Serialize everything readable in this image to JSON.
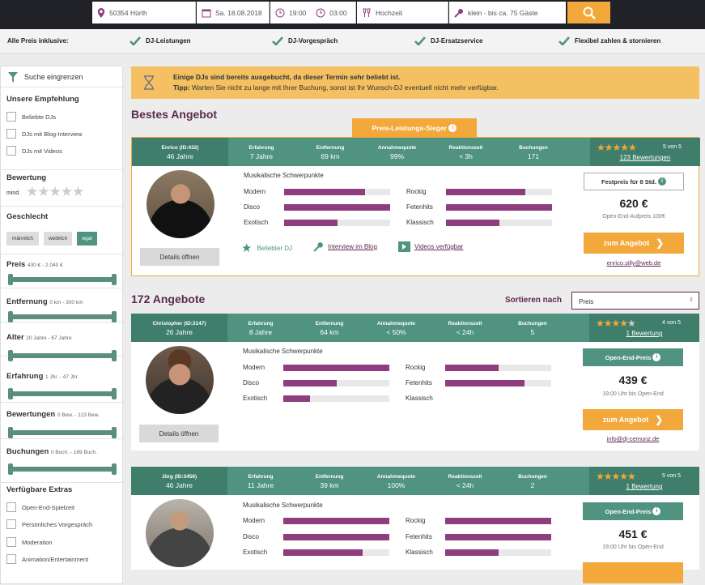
{
  "search": {
    "location": "50354 Hürth",
    "date": "Sa. 18.08.2018",
    "time_from": "19:00",
    "time_to": "03:00",
    "event": "Hochzeit",
    "size": "klein - bis ca. 75 Gäste"
  },
  "inclusive": {
    "label": "Alle Preis inklusive:",
    "items": [
      "DJ-Leistungen",
      "DJ-Vorgespräch",
      "DJ-Ersatzservice",
      "Flexibel zahlen & stornieren"
    ]
  },
  "sidebar": {
    "filter": "Suche eingrenzen",
    "recommend": "Unsere Empfehlung",
    "recommend_items": [
      "Beliebte DJs",
      "DJs mit Blog-Interview",
      "DJs mit Videos"
    ],
    "rating": "Bewertung",
    "rating_min": "mind.",
    "gender": "Geschlecht",
    "gender_opts": [
      "männlich",
      "weiblich",
      "egal"
    ],
    "price": "Preis",
    "price_range": "430 € - 2.040 €",
    "distance": "Entfernung",
    "distance_range": "0 km - 300 km",
    "age": "Alter",
    "age_range": "20 Jahre - 67 Jahre",
    "exp": "Erfahrung",
    "exp_range": "1 Jhr. - 47 Jhr.",
    "reviews": "Bewertungen",
    "reviews_range": "0 Bew. - 123 Bew.",
    "bookings": "Buchungen",
    "bookings_range": "0 Buch. - 189 Buch.",
    "extras": "Verfügbare Extras",
    "extras_items": [
      "Open-End-Spielzeit",
      "Persönliches Vorgespräch",
      "Moderation",
      "Animation/Entertainment"
    ]
  },
  "banner": {
    "line1": "Einige DJs sind bereits ausgebucht, da dieser Termin sehr beliebt ist.",
    "tip_label": "Tipp:",
    "tip": "Warten Sie nicht zu lange mit Ihrer Buchung, sonst ist Ihr Wunsch-DJ eventuell nicht mehr verfügbar."
  },
  "best": {
    "heading": "Bestes Angebot",
    "badge": "Preis-Leistungs-Sieger"
  },
  "list": {
    "heading": "172 Angebote",
    "sort_label": "Sortieren nach",
    "sort_value": "Preis"
  },
  "labels": {
    "exp": "Erfahrung",
    "dist": "Entfernung",
    "accept": "Annahmequote",
    "react": "Reaktionszeit",
    "book": "Buchungen",
    "ms": "Musikalische Schwerpunkte",
    "details": "Details öffnen",
    "cta": "zum Angebot",
    "genres": [
      "Modern",
      "Disco",
      "Exotisch",
      "Rockig",
      "Fetenhits",
      "Klassisch"
    ]
  },
  "cards": [
    {
      "name": "Enrico",
      "id": "(ID:432)",
      "age": "46 Jahre",
      "exp": "7 Jahre",
      "dist": "69 km",
      "accept": "99%",
      "react": "< 3h",
      "book": "171",
      "stars": 5,
      "score": "5 von 5",
      "reviews": "123 Bewertungen",
      "bars": [
        0.76,
        1.0,
        0.5,
        0.75,
        1.0,
        0.5
      ],
      "price_tag": "Festpreis für 8 Std.",
      "price": "620 €",
      "price_sub": "Open-End-Aufpreis 100€",
      "email": "enrico.silly@web.de",
      "features": [
        "Beliebter DJ",
        "Interview im Blog",
        "Videos verfügbar"
      ]
    },
    {
      "name": "Christopher",
      "id": "(ID:3147)",
      "age": "26 Jahre",
      "exp": "8 Jahre",
      "dist": "64 km",
      "accept": "< 50%",
      "react": "< 24h",
      "book": "5",
      "stars": 4,
      "score": "4 von 5",
      "reviews": "1 Bewertung",
      "bars": [
        1.0,
        0.5,
        0.25,
        0.5,
        0.75,
        0
      ],
      "price_tag": "Open-End-Preis",
      "price": "439 €",
      "price_sub": "19:00 Uhr bis Open-End",
      "email": "info@dj-cemunz.de"
    },
    {
      "name": "Jörg",
      "id": "(ID:3456)",
      "age": "46 Jahre",
      "exp": "11 Jahre",
      "dist": "39 km",
      "accept": "100%",
      "react": "< 24h",
      "book": "2",
      "stars": 5,
      "score": "5 von 5",
      "reviews": "1 Bewertung",
      "bars": [
        1.0,
        1.0,
        0.75,
        1.0,
        1.0,
        0.5
      ],
      "price_tag": "Open-End-Preis",
      "price": "451 €",
      "price_sub": "19:00 Uhr bis Open-End"
    }
  ],
  "colors": {
    "accent": "#f2a83a",
    "green": "#4f9380",
    "purple": "#8e3d7e"
  }
}
